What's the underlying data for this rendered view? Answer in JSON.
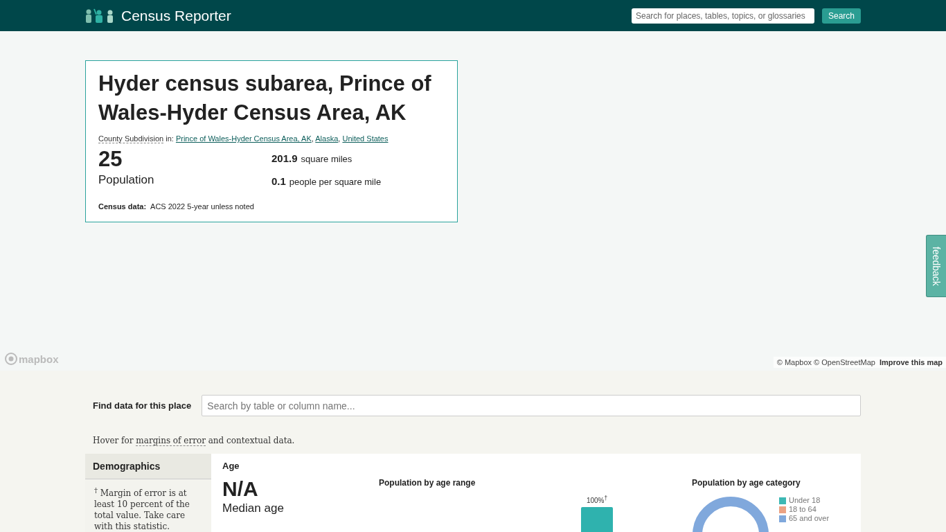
{
  "header": {
    "logo_text": "Census Reporter",
    "search": {
      "placeholder": "Search for places, tables, topics, or glossaries"
    },
    "search_button": "Search"
  },
  "place": {
    "title": "Hyder census subarea, Prince of Wales-Hyder Census Area, AK",
    "sumlev": "County Subdivision",
    "in_label": "in:",
    "parent_separator": ",",
    "parents": [
      "Prince of Wales-Hyder Census Area, AK",
      "Alaska",
      "United States"
    ],
    "population": "25",
    "population_label": "Population",
    "area": "201.9",
    "area_unit": "square miles",
    "density": "0.1",
    "density_unit": "people per square mile",
    "census_label": "Census data:",
    "census_value": "ACS 2022 5-year unless noted"
  },
  "map": {
    "logo": "mapbox",
    "attribution": "© Mapbox © OpenStreetMap",
    "improve_link": "Improve this map"
  },
  "feedback": "feedback",
  "find": {
    "label": "Find data for this place",
    "placeholder": "Search by table or column name..."
  },
  "hover_note": {
    "before": "Hover for",
    "link": "margins of error",
    "after": "and contextual data."
  },
  "sidebar": {
    "heading": "Demographics",
    "note": "$^{†}$ Margin of error is at least 10 percent of the total value. Take care with this statistic."
  },
  "age": {
    "title": "Age",
    "median": "N/A",
    "median_label": "Median age",
    "range_chart_title": "Population by age range",
    "bar_label": "100%$^{†}$",
    "category_chart_title": "Population by age category",
    "legend": [
      {
        "label": "Under 18",
        "color": "#3db8b4"
      },
      {
        "label": "18 to 64",
        "color": "#eba284"
      },
      {
        "label": "65 and over",
        "color": "#80a8dc"
      }
    ]
  }
}
